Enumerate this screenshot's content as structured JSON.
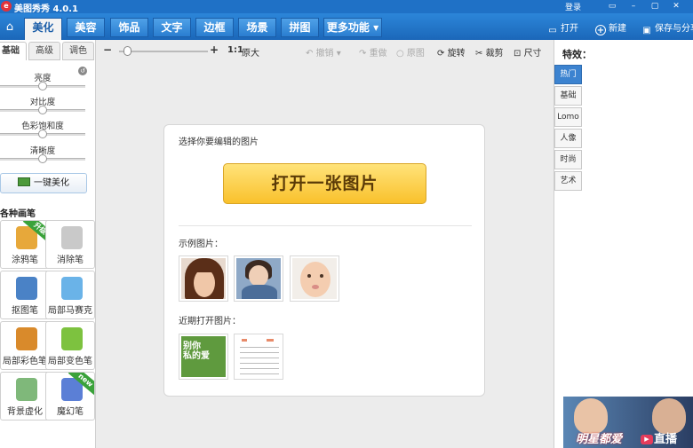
{
  "app": {
    "logo_char": "e",
    "title": "美图秀秀 4.0.1",
    "login": "登录"
  },
  "window_controls": {
    "msg": "▭",
    "min": "–",
    "max": "▢",
    "close": "✕"
  },
  "nav": {
    "home_icon": "home-icon",
    "tabs": [
      "美化",
      "美容",
      "饰品",
      "文字",
      "边框",
      "场景",
      "拼图",
      "更多功能 ▾"
    ],
    "active_tab": "美化",
    "actions": [
      {
        "icon": "folder-icon",
        "glyph": "▭",
        "label": "打开"
      },
      {
        "icon": "plus-circle-icon",
        "glyph": "+",
        "label": "新建"
      },
      {
        "icon": "save-icon",
        "glyph": "▣",
        "label": "保存与分享"
      }
    ]
  },
  "left_panel": {
    "subtabs": [
      "基础",
      "高级",
      "调色"
    ],
    "active_subtab": "基础",
    "sliders": [
      {
        "label": "亮度",
        "value": 0.5
      },
      {
        "label": "对比度",
        "value": 0.5
      },
      {
        "label": "色彩饱和度",
        "value": 0.5
      },
      {
        "label": "清晰度",
        "value": 0.5
      }
    ],
    "one_click": "一键美化",
    "brush_section": "各种画笔",
    "brushes": [
      {
        "label": "涂鸦笔",
        "badge": "升级",
        "badge_color": "#3aa23a",
        "color": "#e7a83a"
      },
      {
        "label": "消除笔",
        "badge": "",
        "badge_color": "",
        "color": "#c9c9c9"
      },
      {
        "label": "抠图笔",
        "badge": "",
        "badge_color": "",
        "color": "#4a82c6"
      },
      {
        "label": "局部马赛克",
        "badge": "",
        "badge_color": "",
        "color": "#6ab3e8"
      },
      {
        "label": "局部彩色笔",
        "badge": "",
        "badge_color": "",
        "color": "#d98a2b"
      },
      {
        "label": "局部变色笔",
        "badge": "",
        "badge_color": "",
        "color": "#7dc23f"
      },
      {
        "label": "背景虚化",
        "badge": "",
        "badge_color": "",
        "color": "#7fb87a"
      },
      {
        "label": "魔幻笔",
        "badge": "new",
        "badge_color": "#3aa23a",
        "color": "#5b7fd6"
      }
    ]
  },
  "toolbar": {
    "zoom_out": "−",
    "zoom_in": "+",
    "zoom_value": 0.05,
    "ratio": "1:1",
    "original_size": "原大",
    "undo": "撤销",
    "redo": "重做",
    "original": "原图",
    "rotate": "旋转",
    "crop": "裁剪",
    "size": "尺寸"
  },
  "card": {
    "title": "选择你要编辑的图片",
    "open_button": "打开一张图片",
    "samples_label": "示例图片：",
    "recent_label": "近期打开图片：",
    "recent_first_text": "别你\n私的爱"
  },
  "right_panel": {
    "title": "特效：",
    "tabs": [
      "热门",
      "基础",
      "Lomo",
      "人像",
      "时尚",
      "艺术"
    ],
    "active_tab": "热门"
  },
  "banner": {
    "text1": "明星都爱",
    "text2": "直播"
  },
  "colors": {
    "primary": "#1f71c6",
    "button_yellow": "#f9c12c",
    "active_blue": "#3c83d0"
  }
}
